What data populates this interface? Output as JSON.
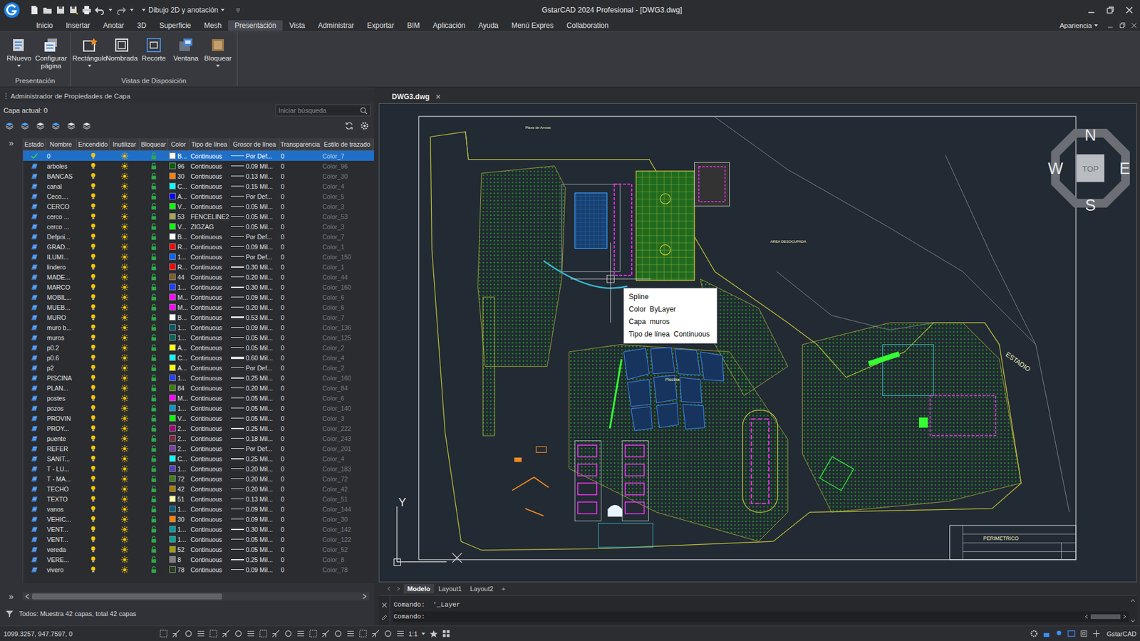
{
  "window": {
    "title": "GstarCAD 2024 Profesional - [DWG3.dwg]",
    "workspace": "Dibujo 2D y anotación"
  },
  "menu_tabs": [
    {
      "label": "Inicio",
      "selected": false
    },
    {
      "label": "Insertar",
      "selected": false
    },
    {
      "label": "Anotar",
      "selected": false
    },
    {
      "label": "3D",
      "selected": false
    },
    {
      "label": "Superficie",
      "selected": false
    },
    {
      "label": "Mesh",
      "selected": false
    },
    {
      "label": "Presentación",
      "selected": true
    },
    {
      "label": "Vista",
      "selected": false
    },
    {
      "label": "Administrar",
      "selected": false
    },
    {
      "label": "Exportar",
      "selected": false
    },
    {
      "label": "BIM",
      "selected": false
    },
    {
      "label": "Aplicación",
      "selected": false
    },
    {
      "label": "Ayuda",
      "selected": false
    },
    {
      "label": "Menú Expres",
      "selected": false
    },
    {
      "label": "Collaboration",
      "selected": false
    }
  ],
  "appearance": "Apariencia",
  "ribbon": [
    {
      "label": "Presentación",
      "tools": [
        {
          "label": "RNuevo",
          "dropdown": true
        },
        {
          "label": "Configurar página",
          "dropdown": false
        }
      ]
    },
    {
      "label": "Vistas de Disposición",
      "tools": [
        {
          "label": "Rectángulo",
          "dropdown": true
        },
        {
          "label": "Nombrada",
          "dropdown": false
        },
        {
          "label": "Recorte",
          "dropdown": false
        },
        {
          "label": "Ventana",
          "dropdown": false
        },
        {
          "label": "Bloquear",
          "dropdown": true
        }
      ]
    }
  ],
  "layer_panel": {
    "title": "Administrador de Propiedades de Capa",
    "current_layer": "Capa actual: 0",
    "search_placeholder": "Iniciar búsqueda",
    "expand_glyph": "»",
    "columns": [
      "Estado",
      "Nombre",
      "Encendido",
      "Inutilizar",
      "Bloquear",
      "Color",
      "Tipo de línea",
      "Grosor de línea",
      "Transparencia",
      "Estilo de trazado"
    ],
    "rows": [
      {
        "name": "0",
        "current": true,
        "selected": true,
        "on": true,
        "frozen": false,
        "locked": false,
        "color_label": "B...",
        "color": "#ffffff",
        "linetype": "Continuous",
        "lineweight": "Por Def...",
        "transparency": "0",
        "plot_style": "Color_7"
      },
      {
        "name": "arboles",
        "current": false,
        "selected": false,
        "on": true,
        "frozen": false,
        "locked": false,
        "color_label": "96",
        "color": "#0b5f0b",
        "linetype": "Continuous",
        "lineweight": "0.09 Mil...",
        "transparency": "0",
        "plot_style": "Color_96"
      },
      {
        "name": "BANCAS",
        "current": false,
        "selected": false,
        "on": true,
        "frozen": false,
        "locked": false,
        "color_label": "30",
        "color": "#ff7f00",
        "linetype": "Continuous",
        "lineweight": "0.13 Mil...",
        "transparency": "0",
        "plot_style": "Color_30"
      },
      {
        "name": "canal",
        "current": false,
        "selected": false,
        "on": true,
        "frozen": false,
        "locked": false,
        "color_label": "C...",
        "color": "#00ffff",
        "linetype": "Continuous",
        "lineweight": "0.15 Mil...",
        "transparency": "0",
        "plot_style": "Color_4"
      },
      {
        "name": "Ceco....",
        "current": false,
        "selected": false,
        "on": true,
        "frozen": false,
        "locked": false,
        "color_label": "A...",
        "color": "#0000ff",
        "linetype": "Continuous",
        "lineweight": "Por Def...",
        "transparency": "0",
        "plot_style": "Color_5"
      },
      {
        "name": "CERCO",
        "current": false,
        "selected": false,
        "on": true,
        "frozen": false,
        "locked": false,
        "color_label": "V...",
        "color": "#00ff00",
        "linetype": "Continuous",
        "lineweight": "0.05 Mil...",
        "transparency": "0",
        "plot_style": "Color_3"
      },
      {
        "name": "cerco ...",
        "current": false,
        "selected": false,
        "on": true,
        "frozen": false,
        "locked": false,
        "color_label": "53",
        "color": "#a5a552",
        "linetype": "FENCELINE2",
        "lineweight": "0.05 Mil...",
        "transparency": "0",
        "plot_style": "Color_53"
      },
      {
        "name": "cerco ...",
        "current": false,
        "selected": false,
        "on": true,
        "frozen": false,
        "locked": false,
        "color_label": "V...",
        "color": "#00ff00",
        "linetype": "ZIGZAG",
        "lineweight": "0.05 Mil...",
        "transparency": "0",
        "plot_style": "Color_3"
      },
      {
        "name": "Defpoi...",
        "current": false,
        "selected": false,
        "on": true,
        "frozen": false,
        "locked": false,
        "color_label": "B...",
        "color": "#ffffff",
        "linetype": "Continuous",
        "lineweight": "Por Def...",
        "transparency": "0",
        "plot_style": "Color_7"
      },
      {
        "name": "GRAD...",
        "current": false,
        "selected": false,
        "on": true,
        "frozen": false,
        "locked": false,
        "color_label": "R...",
        "color": "#ff0000",
        "linetype": "Continuous",
        "lineweight": "0.09 Mil...",
        "transparency": "0",
        "plot_style": "Color_1"
      },
      {
        "name": "ILUMI...",
        "current": false,
        "selected": false,
        "on": true,
        "frozen": false,
        "locked": false,
        "color_label": "1...",
        "color": "#0066ff",
        "linetype": "Continuous",
        "lineweight": "Por Def...",
        "transparency": "0",
        "plot_style": "Color_150"
      },
      {
        "name": "lindero",
        "current": false,
        "selected": false,
        "on": true,
        "frozen": false,
        "locked": false,
        "color_label": "R...",
        "color": "#ff0000",
        "linetype": "Continuous",
        "lineweight": "0.30 Mil...",
        "transparency": "0",
        "plot_style": "Color_1"
      },
      {
        "name": "MADE...",
        "current": false,
        "selected": false,
        "on": true,
        "frozen": false,
        "locked": false,
        "color_label": "44",
        "color": "#7f5f26",
        "linetype": "Continuous",
        "lineweight": "0.20 Mil...",
        "transparency": "0",
        "plot_style": "Color_44"
      },
      {
        "name": "MARCO",
        "current": false,
        "selected": false,
        "on": true,
        "frozen": false,
        "locked": false,
        "color_label": "1...",
        "color": "#1f3fff",
        "linetype": "Continuous",
        "lineweight": "0.30 Mil...",
        "transparency": "0",
        "plot_style": "Color_160"
      },
      {
        "name": "MOBIL...",
        "current": false,
        "selected": false,
        "on": true,
        "frozen": false,
        "locked": false,
        "color_label": "M...",
        "color": "#ff00ff",
        "linetype": "Continuous",
        "lineweight": "0.09 Mil...",
        "transparency": "0",
        "plot_style": "Color_6"
      },
      {
        "name": "MUEB...",
        "current": false,
        "selected": false,
        "on": true,
        "frozen": false,
        "locked": false,
        "color_label": "M...",
        "color": "#ff00ff",
        "linetype": "Continuous",
        "lineweight": "0.20 Mil...",
        "transparency": "0",
        "plot_style": "Color_6"
      },
      {
        "name": "MURO",
        "current": false,
        "selected": false,
        "on": true,
        "frozen": false,
        "locked": false,
        "color_label": "B...",
        "color": "#ffffff",
        "linetype": "Continuous",
        "lineweight": "0.53 Mil...",
        "transparency": "0",
        "plot_style": "Color_7"
      },
      {
        "name": "muro b...",
        "current": false,
        "selected": false,
        "on": true,
        "frozen": false,
        "locked": false,
        "color_label": "1...",
        "color": "#00596a",
        "linetype": "Continuous",
        "lineweight": "0.09 Mil...",
        "transparency": "0",
        "plot_style": "Color_136"
      },
      {
        "name": "muros",
        "current": false,
        "selected": false,
        "on": true,
        "frozen": false,
        "locked": false,
        "color_label": "1...",
        "color": "#00665a",
        "linetype": "Continuous",
        "lineweight": "0.05 Mil...",
        "transparency": "0",
        "plot_style": "Color_125"
      },
      {
        "name": "p0.2",
        "current": false,
        "selected": false,
        "on": true,
        "frozen": false,
        "locked": false,
        "color_label": "A...",
        "color": "#ffff00",
        "linetype": "Continuous",
        "lineweight": "0.05 Mil...",
        "transparency": "0",
        "plot_style": "Color_2"
      },
      {
        "name": "p0.6",
        "current": false,
        "selected": false,
        "on": true,
        "frozen": false,
        "locked": false,
        "color_label": "C...",
        "color": "#00ffff",
        "linetype": "Continuous",
        "lineweight": "0.60 Mil...",
        "transparency": "0",
        "plot_style": "Color_4"
      },
      {
        "name": "p2",
        "current": false,
        "selected": false,
        "on": true,
        "frozen": false,
        "locked": false,
        "color_label": "A...",
        "color": "#ffff00",
        "linetype": "Continuous",
        "lineweight": "Por Def...",
        "transparency": "0",
        "plot_style": "Color_2"
      },
      {
        "name": "PISCINA",
        "current": false,
        "selected": false,
        "on": true,
        "frozen": false,
        "locked": false,
        "color_label": "1...",
        "color": "#1f3fff",
        "linetype": "Continuous",
        "lineweight": "0.25 Mil...",
        "transparency": "0",
        "plot_style": "Color_160"
      },
      {
        "name": "PLAN...",
        "current": false,
        "selected": false,
        "on": true,
        "frozen": false,
        "locked": false,
        "color_label": "84",
        "color": "#3f7f00",
        "linetype": "Continuous",
        "lineweight": "0.20 Mil...",
        "transparency": "0",
        "plot_style": "Color_84"
      },
      {
        "name": "postes",
        "current": false,
        "selected": false,
        "on": true,
        "frozen": false,
        "locked": false,
        "color_label": "M...",
        "color": "#ff00ff",
        "linetype": "Continuous",
        "lineweight": "0.05 Mil...",
        "transparency": "0",
        "plot_style": "Color_6"
      },
      {
        "name": "pozos",
        "current": false,
        "selected": false,
        "on": true,
        "frozen": false,
        "locked": false,
        "color_label": "1...",
        "color": "#0099cc",
        "linetype": "Continuous",
        "lineweight": "0.05 Mil...",
        "transparency": "0",
        "plot_style": "Color_140"
      },
      {
        "name": "PROVIN",
        "current": false,
        "selected": false,
        "on": true,
        "frozen": false,
        "locked": false,
        "color_label": "V...",
        "color": "#00ff00",
        "linetype": "Continuous",
        "lineweight": "0.05 Mil...",
        "transparency": "0",
        "plot_style": "Color_3"
      },
      {
        "name": "PROY...",
        "current": false,
        "selected": false,
        "on": true,
        "frozen": false,
        "locked": false,
        "color_label": "2...",
        "color": "#a5007a",
        "linetype": "Continuous",
        "lineweight": "0.25 Mil...",
        "transparency": "0",
        "plot_style": "Color_222"
      },
      {
        "name": "puente",
        "current": false,
        "selected": false,
        "on": true,
        "frozen": false,
        "locked": false,
        "color_label": "2...",
        "color": "#7f2640",
        "linetype": "Continuous",
        "lineweight": "0.18 Mil...",
        "transparency": "0",
        "plot_style": "Color_243"
      },
      {
        "name": "REFER",
        "current": false,
        "selected": false,
        "on": true,
        "frozen": false,
        "locked": false,
        "color_label": "2...",
        "color": "#7a3fa5",
        "linetype": "Continuous",
        "lineweight": "Por Def...",
        "transparency": "0",
        "plot_style": "Color_201"
      },
      {
        "name": "SANIT...",
        "current": false,
        "selected": false,
        "on": true,
        "frozen": false,
        "locked": false,
        "color_label": "C...",
        "color": "#00ffff",
        "linetype": "Continuous",
        "lineweight": "0.25 Mil...",
        "transparency": "0",
        "plot_style": "Color_4"
      },
      {
        "name": "T - LU...",
        "current": false,
        "selected": false,
        "on": true,
        "frozen": false,
        "locked": false,
        "color_label": "1...",
        "color": "#4f3fbf",
        "linetype": "Continuous",
        "lineweight": "0.20 Mil...",
        "transparency": "0",
        "plot_style": "Color_183"
      },
      {
        "name": "T - MA...",
        "current": false,
        "selected": false,
        "on": true,
        "frozen": false,
        "locked": false,
        "color_label": "72",
        "color": "#3f7f1f",
        "linetype": "Continuous",
        "lineweight": "0.20 Mil...",
        "transparency": "0",
        "plot_style": "Color_72"
      },
      {
        "name": "TECHO",
        "current": false,
        "selected": false,
        "on": true,
        "frozen": false,
        "locked": false,
        "color_label": "42",
        "color": "#a57f00",
        "linetype": "Continuous",
        "lineweight": "0.20 Mil...",
        "transparency": "0",
        "plot_style": "Color_42"
      },
      {
        "name": "TEXTO",
        "current": false,
        "selected": false,
        "on": true,
        "frozen": false,
        "locked": false,
        "color_label": "51",
        "color": "#ffff9f",
        "linetype": "Continuous",
        "lineweight": "0.13 Mil...",
        "transparency": "0",
        "plot_style": "Color_51"
      },
      {
        "name": "vanos",
        "current": false,
        "selected": false,
        "on": true,
        "frozen": false,
        "locked": false,
        "color_label": "1...",
        "color": "#005f7f",
        "linetype": "Continuous",
        "lineweight": "0.09 Mil...",
        "transparency": "0",
        "plot_style": "Color_144"
      },
      {
        "name": "VEHIC...",
        "current": false,
        "selected": false,
        "on": true,
        "frozen": false,
        "locked": false,
        "color_label": "30",
        "color": "#ff7f00",
        "linetype": "Continuous",
        "lineweight": "0.09 Mil...",
        "transparency": "0",
        "plot_style": "Color_30"
      },
      {
        "name": "VENT...",
        "current": false,
        "selected": false,
        "on": true,
        "frozen": false,
        "locked": false,
        "color_label": "1...",
        "color": "#0099a5",
        "linetype": "Continuous",
        "lineweight": "0.30 Mil...",
        "transparency": "0",
        "plot_style": "Color_142"
      },
      {
        "name": "VENT...",
        "current": false,
        "selected": false,
        "on": true,
        "frozen": false,
        "locked": false,
        "color_label": "1...",
        "color": "#00a59a",
        "linetype": "Continuous",
        "lineweight": "0.05 Mil...",
        "transparency": "0",
        "plot_style": "Color_122"
      },
      {
        "name": "vereda",
        "current": false,
        "selected": false,
        "on": true,
        "frozen": false,
        "locked": false,
        "color_label": "52",
        "color": "#9f9f00",
        "linetype": "Continuous",
        "lineweight": "0.05 Mil...",
        "transparency": "0",
        "plot_style": "Color_52"
      },
      {
        "name": "VERE...",
        "current": false,
        "selected": false,
        "on": true,
        "frozen": false,
        "locked": false,
        "color_label": "8",
        "color": "#808080",
        "linetype": "Continuous",
        "lineweight": "0.25 Mil...",
        "transparency": "0",
        "plot_style": "Color_8"
      },
      {
        "name": "vivero",
        "current": false,
        "selected": false,
        "on": true,
        "frozen": false,
        "locked": false,
        "color_label": "78",
        "color": "#26401f",
        "linetype": "Continuous",
        "lineweight": "0.09 Mil...",
        "transparency": "0",
        "plot_style": "Color_78"
      }
    ],
    "summary": "Todos: Muestra 42 capas, total 42 capas"
  },
  "drawing": {
    "tab": "DWG3.dwg",
    "labels": [
      "Plaza de Armas",
      "AREA DESOCUPADA",
      "Piscina",
      "ESTADIO",
      "PERIMETRICO"
    ],
    "tooltip": [
      "Spline",
      "Color  ByLayer",
      "Capa  muros",
      "Tipo de línea  Continuous"
    ],
    "compass": {
      "n": "N",
      "s": "S",
      "e": "E",
      "w": "W",
      "top": "TOP"
    },
    "ucs_y": "Y",
    "layout_tabs": [
      {
        "label": "Modelo",
        "selected": true
      },
      {
        "label": "Layout1",
        "selected": false
      },
      {
        "label": "Layout2",
        "selected": false
      }
    ],
    "new_tab": "+"
  },
  "command": {
    "history": "Comando:  '_Layer",
    "prompt": "Comando:"
  },
  "status_bar": {
    "coords": "1099.3257, 947.7597, 0",
    "scale": "1:1",
    "brand": "GstarCAD"
  }
}
